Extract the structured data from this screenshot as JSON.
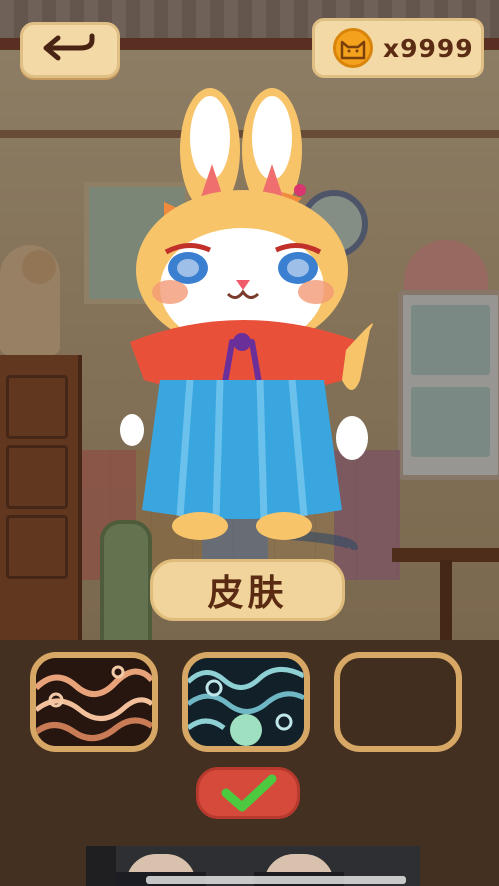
{
  "top_bar": {
    "back_icon": "return-arrow-icon",
    "coin_icon": "cat-coin-icon",
    "coin_count": "x9999"
  },
  "character": {
    "name_icon": "bunny-character"
  },
  "category": {
    "label": "皮肤"
  },
  "skins": {
    "slots": [
      {
        "pattern": "copper-wave-pattern",
        "state": "available"
      },
      {
        "pattern": "blue-cloud-pattern",
        "state": "available"
      },
      {
        "pattern": "empty",
        "state": "empty"
      }
    ]
  },
  "confirm": {
    "icon": "checkmark-icon",
    "color": "#d64a3c"
  },
  "colors": {
    "panel": "#f2d9a6",
    "panel_text": "#5c2b14",
    "slot_border": "#d7a765",
    "check_green": "#4cc93f"
  }
}
